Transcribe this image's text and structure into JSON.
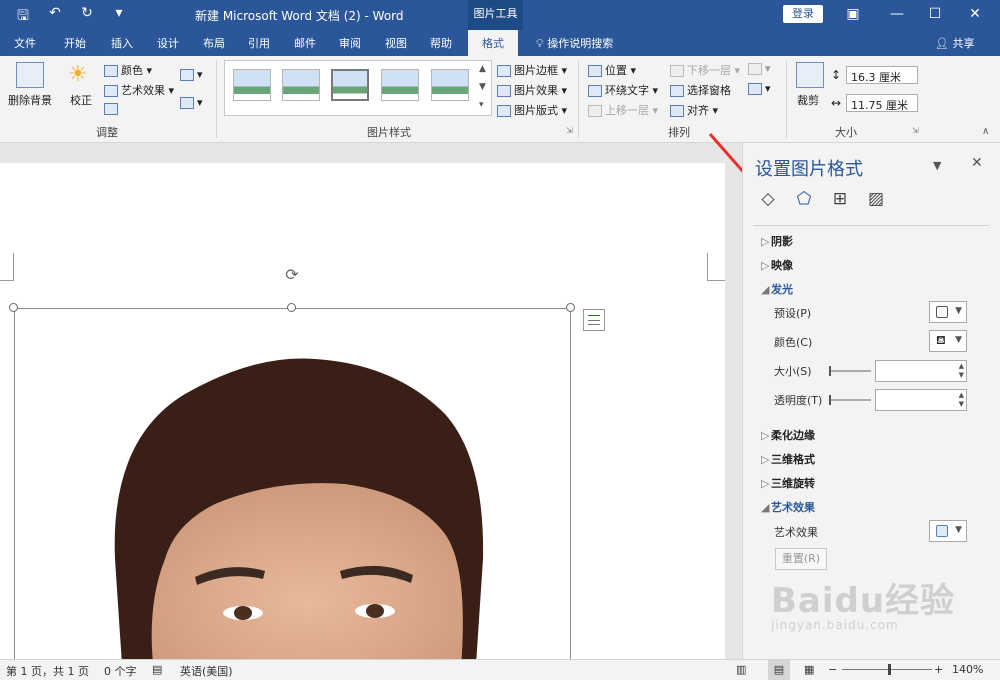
{
  "titlebar": {
    "title": "新建 Microsoft Word 文档 (2)  -  Word",
    "tools_tab": "图片工具",
    "login": "登录",
    "qat_save": "🖫",
    "qat_undo": "↶",
    "qat_redo": "↻",
    "qat_more": "▾"
  },
  "tabs": {
    "file": "文件",
    "home": "开始",
    "insert": "插入",
    "design": "设计",
    "layout": "布局",
    "references": "引用",
    "mailings": "邮件",
    "review": "审阅",
    "view": "视图",
    "help": "帮助",
    "format": "格式",
    "tellme": "操作说明搜索",
    "share": "共享"
  },
  "ribbon": {
    "remove_bg": "删除背景",
    "correct": "校正",
    "color": "颜色",
    "art_effect": "艺术效果",
    "group_adjust": "调整",
    "pic_border": "图片边框",
    "pic_effect": "图片效果",
    "pic_layout": "图片版式",
    "group_styles": "图片样式",
    "position": "位置",
    "wrap_text": "环绕文字",
    "bring_forward": "上移一层",
    "send_backward": "下移一层",
    "selection_pane": "选择窗格",
    "align": "对齐",
    "group_arrange": "排列",
    "crop": "裁剪",
    "height": "16.3 厘米",
    "width": "11.75 厘米",
    "group_size": "大小"
  },
  "pane": {
    "title": "设置图片格式",
    "sections": {
      "shadow": "阴影",
      "reflection": "映像",
      "glow": "发光",
      "soft_edges": "柔化边缘",
      "format_3d": "三维格式",
      "rotation_3d": "三维旋转",
      "artistic": "艺术效果"
    },
    "glow_preset": "预设(P)",
    "glow_color": "颜色(C)",
    "glow_size": "大小(S)",
    "glow_transparency": "透明度(T)",
    "artistic_label": "艺术效果",
    "reset": "重置(R)",
    "watermark_big": "Baidu经验",
    "watermark_small": "jingyan.baidu.com"
  },
  "status": {
    "page": "第 1 页，共 1 页",
    "words": "0 个字",
    "language": "英语(美国)",
    "zoom": "140%"
  },
  "colors": {
    "brand": "#2b579a",
    "arrow": "#e8302a"
  }
}
